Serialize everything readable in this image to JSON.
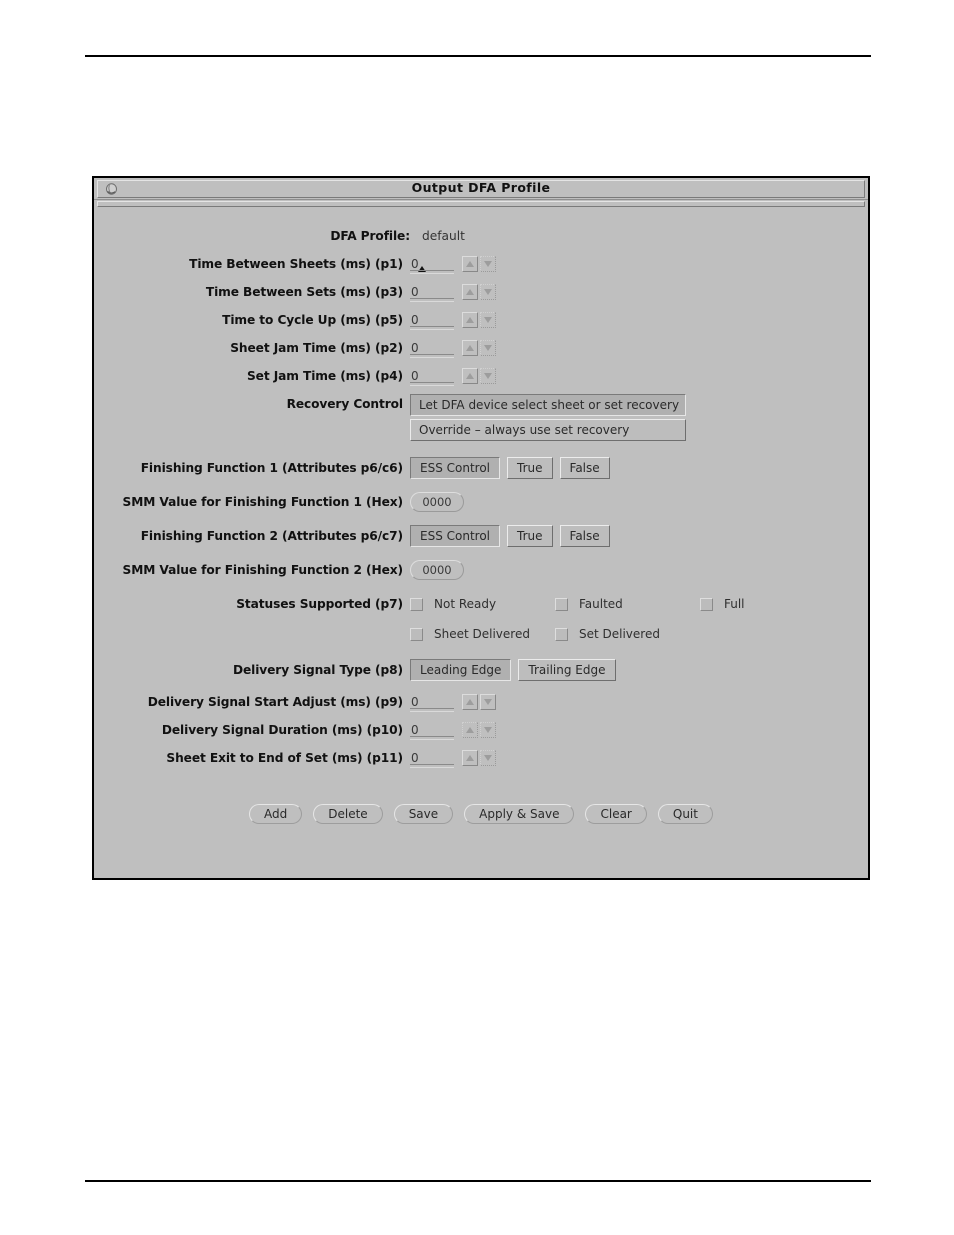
{
  "window": {
    "title": "Output DFA Profile",
    "icon": "window-menu-icon"
  },
  "header": {
    "profile_label": "DFA Profile:",
    "profile_value": "default"
  },
  "fields": [
    {
      "label": "Time Between Sheets (ms) (p1)",
      "value": "0",
      "focused": true
    },
    {
      "label": "Time Between Sets (ms) (p3)",
      "value": "0",
      "focused": false
    },
    {
      "label": "Time to Cycle Up (ms) (p5)",
      "value": "0",
      "focused": false
    },
    {
      "label": "Sheet Jam Time (ms) (p2)",
      "value": "0",
      "focused": false
    },
    {
      "label": "Set Jam Time (ms) (p4)",
      "value": "0",
      "focused": false
    }
  ],
  "recovery": {
    "label": "Recovery Control",
    "options": [
      "Let DFA device select sheet or set recovery",
      "Override – always use set recovery"
    ],
    "selected_index": 0
  },
  "finishing1": {
    "label": "Finishing Function 1 (Attributes p6/c6)",
    "options": [
      "ESS Control",
      "True",
      "False"
    ],
    "selected_index": 0
  },
  "smm1": {
    "label": "SMM Value for Finishing Function 1 (Hex)",
    "value": "0000"
  },
  "finishing2": {
    "label": "Finishing Function 2 (Attributes p6/c7)",
    "options": [
      "ESS Control",
      "True",
      "False"
    ],
    "selected_index": 0
  },
  "smm2": {
    "label": "SMM Value for Finishing Function 2 (Hex)",
    "value": "0000"
  },
  "statuses": {
    "label": "Statuses Supported (p7)",
    "row1": [
      {
        "label": "Not Ready",
        "checked": false
      },
      {
        "label": "Faulted",
        "checked": false
      },
      {
        "label": "Full",
        "checked": false
      }
    ],
    "row2": [
      {
        "label": "Sheet Delivered",
        "checked": false
      },
      {
        "label": "Set Delivered",
        "checked": false
      }
    ]
  },
  "delivery_signal_type": {
    "label": "Delivery Signal Type (p8)",
    "options": [
      "Leading Edge",
      "Trailing Edge"
    ],
    "selected_index": 0
  },
  "tail_fields": [
    {
      "label": "Delivery Signal Start Adjust (ms) (p9)",
      "value": "0"
    },
    {
      "label": "Delivery Signal Duration (ms) (p10)",
      "value": "0"
    },
    {
      "label": "Sheet Exit to End of Set (ms) (p11)",
      "value": "0"
    }
  ],
  "buttons": [
    "Add",
    "Delete",
    "Save",
    "Apply & Save",
    "Clear",
    "Quit"
  ],
  "colors": {
    "dialog_bg": "#bfbfbf",
    "page_bg": "#ffffff",
    "rule": "#000000",
    "text": "#111111"
  }
}
